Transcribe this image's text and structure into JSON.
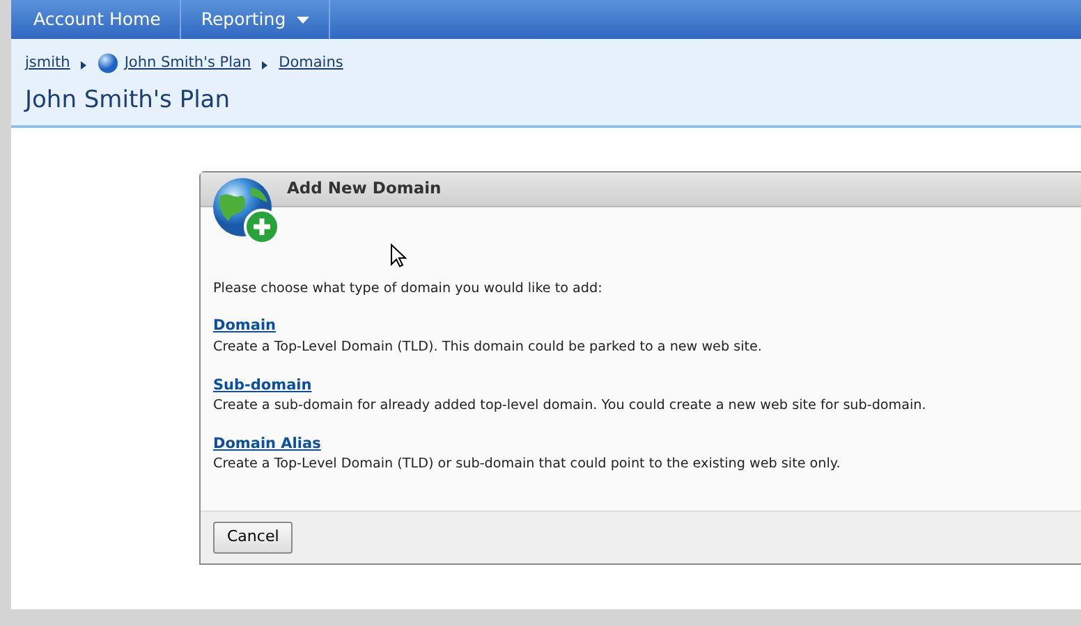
{
  "nav": {
    "items": [
      {
        "label": "Account Home",
        "dropdown": false
      },
      {
        "label": "Reporting",
        "dropdown": true
      }
    ]
  },
  "breadcrumb": [
    {
      "label": "jsmith",
      "icon": false
    },
    {
      "label": "John Smith's Plan",
      "icon": true
    },
    {
      "label": "Domains",
      "icon": false
    }
  ],
  "page_title": "John Smith's Plan",
  "dialog": {
    "title": "Add New Domain",
    "prompt": "Please choose what type of domain you would like to add:",
    "options": [
      {
        "label": "Domain",
        "description": "Create a Top-Level Domain (TLD). This domain could be parked to a new web site."
      },
      {
        "label": "Sub-domain",
        "description": "Create a sub-domain for already added top-level domain. You could create a new web site for sub-domain."
      },
      {
        "label": "Domain Alias",
        "description": "Create a Top-Level Domain (TLD) or sub-domain that could point to the existing web site only."
      }
    ],
    "buttons": [
      "Cancel"
    ]
  }
}
